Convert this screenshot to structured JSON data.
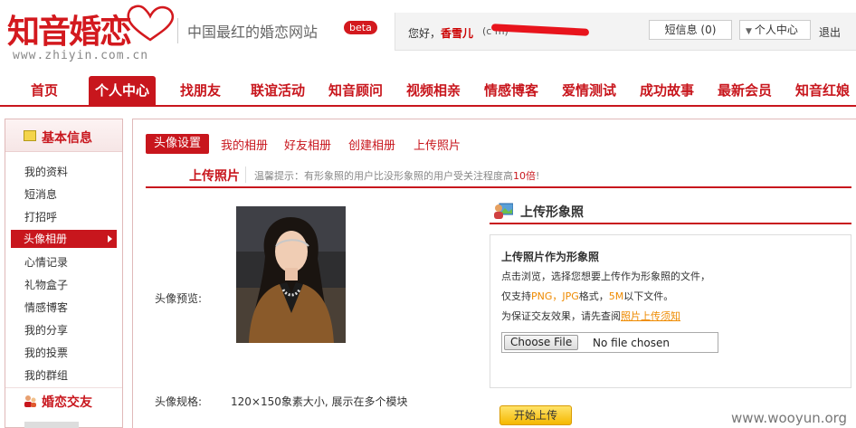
{
  "header": {
    "logo_text": "知音婚恋",
    "logo_url": "www.zhiyin.com.cn",
    "slogan": "中国最红的婚恋网站",
    "beta": "beta"
  },
  "userbar": {
    "greeting": "您好，",
    "username": "香雪儿",
    "email_visible": "(c                              m)",
    "messages": "短信息 (0)",
    "center": "个人中心",
    "logout": "退出"
  },
  "nav": {
    "items": [
      "首页",
      "个人中心",
      "找朋友",
      "联谊活动",
      "知音顾问",
      "视频相亲",
      "情感博客",
      "爱情测试",
      "成功故事",
      "最新会员",
      "知音红娘"
    ],
    "active": "个人中心"
  },
  "sidebar": {
    "section1": "基本信息",
    "items": [
      "我的资料",
      "短消息",
      "打招呼",
      "头像相册",
      "心情记录",
      "礼物盒子",
      "情感博客",
      "我的分享",
      "我的投票",
      "我的群组"
    ],
    "active": "头像相册",
    "section2": "婚恋交友"
  },
  "tabs": [
    "头像设置",
    "我的相册",
    "好友相册",
    "创建相册",
    "上传照片"
  ],
  "sub": {
    "title": "上传照片",
    "tip_prefix": "温馨提示：有形象照的用户比没形象照的用户受关注程度高",
    "tip_highlight": "10倍",
    "tip_suffix": "!"
  },
  "preview": {
    "label": "头像预览:",
    "spec_label": "头像规格:",
    "spec_value": "120×150象素大小, 展示在多个模块"
  },
  "upload": {
    "title": "上传形象照",
    "head": "上传照片作为形象照",
    "line1": "点击浏览，选择您想要上传作为形象照的文件，",
    "line2_prefix": "仅支持",
    "line2_fmt": "PNG，JPG",
    "line2_mid": "格式，",
    "line2_size": "5M",
    "line2_suffix": "以下文件。",
    "line3_prefix": "为保证交友效果，请先查阅",
    "line3_link": "照片上传须知",
    "file_button": "Choose File",
    "file_status": "No file chosen",
    "start_button": "开始上传"
  },
  "watermark": "www.wooyun.org",
  "colors": {
    "brand_red": "#c8161d",
    "accent_orange": "#ee8a00",
    "button_yellow": "#f5b800"
  }
}
